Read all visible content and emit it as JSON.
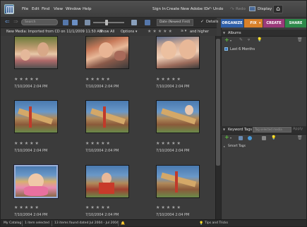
{
  "menubar": {
    "items": [
      "File",
      "Edit",
      "Find",
      "View",
      "Window",
      "Help"
    ],
    "sign_in": "Sign In",
    "create_id": "Create New Adobe ID",
    "undo": "Undo",
    "redo": "Redo",
    "display": "Display ▾"
  },
  "modes": {
    "organize": "ORGANIZE",
    "fix": "FIX",
    "create": "CREATE",
    "share": "SHARE",
    "colors": {
      "organize": "#2f5fa8",
      "fix": "#d9812a",
      "create": "#9a3a7a",
      "share": "#2e8a4a"
    }
  },
  "toolbar": {
    "search_placeholder": "Search",
    "sort_selected": "Date (Newest First)",
    "details_label": "Details"
  },
  "subbar": {
    "media_caption": "New Media: Imported from CD on 11/1/2009 11:50 AM",
    "show_all": "Show All",
    "options": "Options ▾",
    "and_higher": "and higher"
  },
  "photos": [
    {
      "stars": "★★★★★",
      "date": "7/10/2004 2:04 PM",
      "selected": false
    },
    {
      "stars": "★★★★★",
      "date": "7/10/2004 2:04 PM",
      "selected": false
    },
    {
      "stars": "★★★★★",
      "date": "7/10/2004 2:04 PM",
      "selected": false
    },
    {
      "stars": "★★★★★",
      "date": "7/10/2004 2:04 PM",
      "selected": false
    },
    {
      "stars": "★★★★★",
      "date": "7/10/2004 2:04 PM",
      "selected": false
    },
    {
      "stars": "★★★★★",
      "date": "7/10/2004 2:04 PM",
      "selected": false
    },
    {
      "stars": "★★★★★",
      "date": "7/10/2004 2:04 PM",
      "selected": true
    },
    {
      "stars": "★★★★★",
      "date": "7/10/2004 2:04 PM",
      "selected": false
    },
    {
      "stars": "★★★★★",
      "date": "7/10/2004 2:04 PM",
      "selected": false
    }
  ],
  "albums": {
    "title": "Albums",
    "item": "Last 6 Months"
  },
  "keyword_tags": {
    "title": "Keyword Tags",
    "search_placeholder": "Tag selected media",
    "apply": "Apply",
    "smart_tags": "Smart Tags"
  },
  "status": {
    "catalog": "My Catalog",
    "selected": "1 item selected",
    "found": "13 items found dated Jul 2004 - Jul 2004",
    "tips": "Tips and Tricks"
  }
}
